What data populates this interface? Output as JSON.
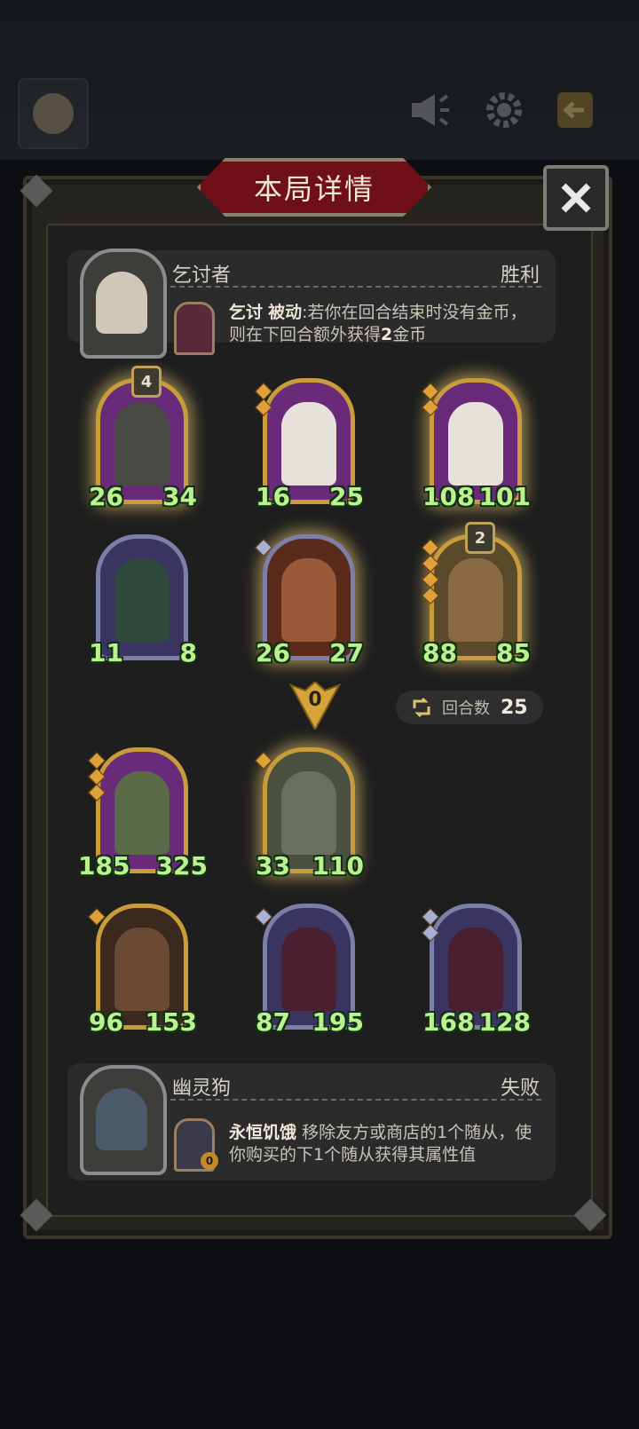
{
  "title": "本局详情",
  "top_icons": [
    "avatar-button",
    "speaker-icon",
    "gear-icon",
    "exit-icon"
  ],
  "players": [
    {
      "name": "乞讨者",
      "result": "胜利",
      "skill_name": "乞讨",
      "skill_type": "被动",
      "skill_desc_1": ":若你在回合结束时没有金币，",
      "skill_desc_2": "则在下回合额外获得",
      "skill_amount": "2",
      "skill_desc_3": "金币"
    },
    {
      "name": "幽灵狗",
      "result": "失败",
      "skill_name": "永恒饥饿",
      "skill_desc": "移除友方或商店的1个随从，使你购买的下1个随从获得其属性值",
      "hero_level": "0"
    }
  ],
  "top_board": [
    {
      "attack": "26",
      "health": "34",
      "badge": "4",
      "tier_gems": 0
    },
    {
      "attack": "16",
      "health": "25",
      "tier_gems": 2
    },
    {
      "attack": "108",
      "health": "101",
      "tier_gems": 2
    },
    {
      "attack": "11",
      "health": "8",
      "tier_gems": 0
    },
    {
      "attack": "26",
      "health": "27",
      "tier_gems": 1
    },
    {
      "attack": "88",
      "health": "85",
      "badge": "2",
      "tier_gems": 4
    }
  ],
  "divider_value": "0",
  "rounds_label": "回合数",
  "rounds_value": "25",
  "bottom_board": [
    {
      "attack": "185",
      "health": "325",
      "tier_gems": 3
    },
    {
      "attack": "33",
      "health": "110",
      "tier_gems": 1
    },
    {
      "attack": "96",
      "health": "153",
      "tier_gems": 1
    },
    {
      "attack": "87",
      "health": "195",
      "tier_gems": 1
    },
    {
      "attack": "168",
      "health": "128",
      "tier_gems": 2
    }
  ],
  "colors": {
    "stat_text": "#b9f28e",
    "attack_orb": "#2f6c8c",
    "health_orb": "#b12f37",
    "gold_frame": "#c99b3a",
    "title_red": "#6e1015"
  }
}
